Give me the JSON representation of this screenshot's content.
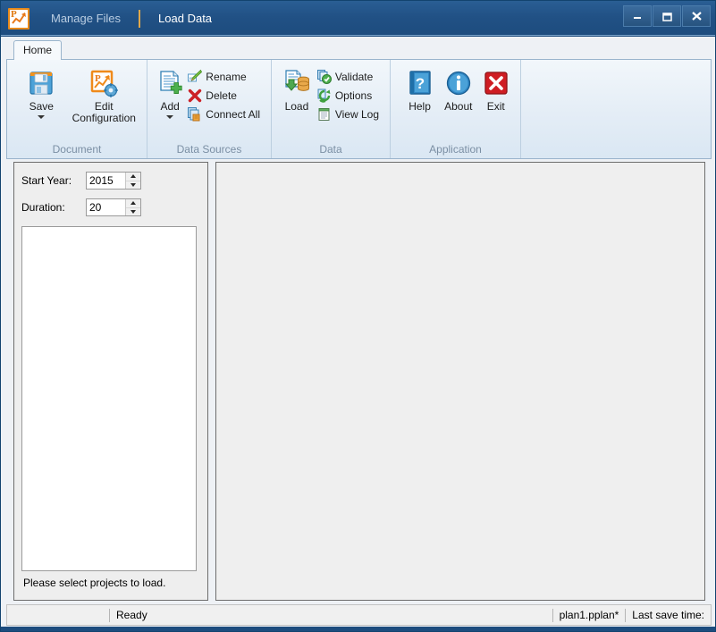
{
  "window": {
    "app_icon": "chart-app-icon",
    "menu": [
      {
        "label": "Manage Files",
        "active": false
      },
      {
        "label": "Load Data",
        "active": true
      }
    ],
    "controls": {
      "minimize": "minimize-icon",
      "maximize": "maximize-icon",
      "close": "close-icon"
    }
  },
  "ribbon": {
    "tabs": [
      {
        "label": "Home",
        "selected": true
      }
    ],
    "groups": [
      {
        "title": "Document",
        "big_buttons": [
          {
            "label": "Save",
            "icon": "floppy-disk-icon",
            "has_dropdown": true
          },
          {
            "label": "Edit Configuration",
            "icon": "configuration-gear-icon",
            "has_dropdown": false
          }
        ],
        "small_buttons": []
      },
      {
        "title": "Data Sources",
        "big_buttons": [
          {
            "label": "Add",
            "icon": "add-document-icon",
            "has_dropdown": true
          }
        ],
        "small_buttons": [
          {
            "label": "Rename",
            "icon": "rename-pencil-icon"
          },
          {
            "label": "Delete",
            "icon": "delete-x-icon"
          },
          {
            "label": "Connect All",
            "icon": "connect-all-icon"
          }
        ]
      },
      {
        "title": "Data",
        "big_buttons": [
          {
            "label": "Load",
            "icon": "load-database-icon",
            "has_dropdown": false
          }
        ],
        "small_buttons": [
          {
            "label": "Validate",
            "icon": "validate-check-icon"
          },
          {
            "label": "Options",
            "icon": "options-refresh-icon"
          },
          {
            "label": "View Log",
            "icon": "view-log-icon"
          }
        ]
      },
      {
        "title": "Application",
        "big_buttons": [
          {
            "label": "Help",
            "icon": "help-book-icon",
            "has_dropdown": false
          },
          {
            "label": "About",
            "icon": "about-info-icon",
            "has_dropdown": false
          },
          {
            "label": "Exit",
            "icon": "exit-x-icon",
            "has_dropdown": false
          }
        ],
        "small_buttons": []
      }
    ]
  },
  "left_panel": {
    "start_year": {
      "label": "Start Year:",
      "value": "2015"
    },
    "duration": {
      "label": "Duration:",
      "value": "20"
    },
    "project_list": {
      "items": []
    },
    "status_message": "Please select projects to load."
  },
  "right_panel": {
    "content": ""
  },
  "statusbar": {
    "ready_text": "Ready",
    "file_name": "plan1.pplan*",
    "last_save": "Last save time:"
  },
  "colors": {
    "titlebar": "#215185",
    "accent_orange": "#e0a84b",
    "ribbon_bg": "#e4edf6",
    "panel_bg": "#eeeeee",
    "group_label": "#7b8fa4"
  }
}
